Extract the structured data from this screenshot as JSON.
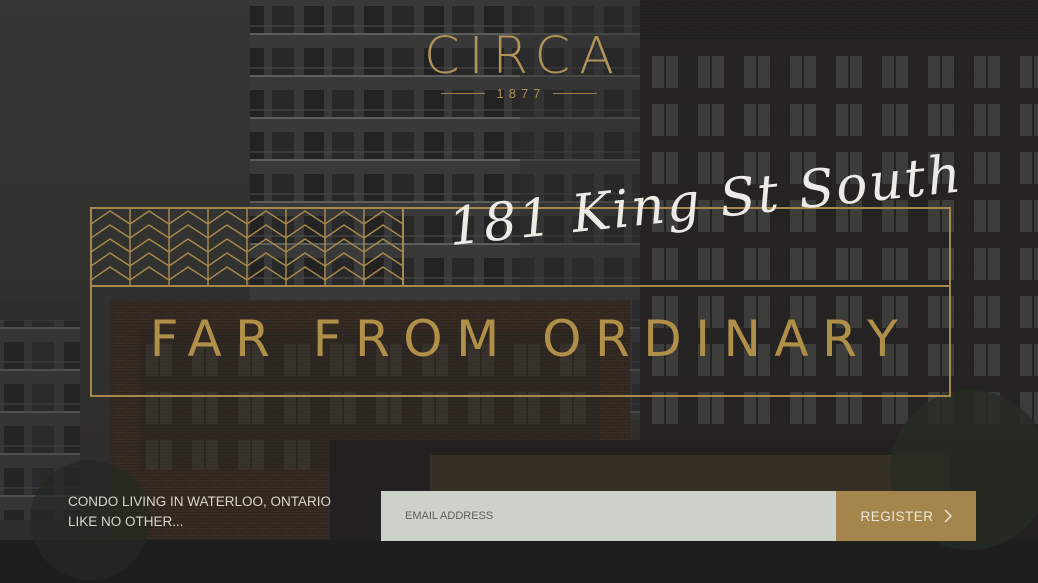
{
  "brand": {
    "logo_text": "CIRCA",
    "year": "1877"
  },
  "hero": {
    "script_address": "181 King St South",
    "tagline": "FAR FROM ORDINARY"
  },
  "intro": {
    "line1": "CONDO LIVING IN WATERLOO, ONTARIO",
    "line2": "LIKE NO OTHER..."
  },
  "signup": {
    "email_placeholder": "EMAIL ADDRESS",
    "register_label": "REGISTER",
    "register_icon": "chevron-right-icon"
  },
  "colors": {
    "gold": "#b08f49",
    "register_bg": "#a4864d",
    "input_bg": "#ccd2ca"
  }
}
